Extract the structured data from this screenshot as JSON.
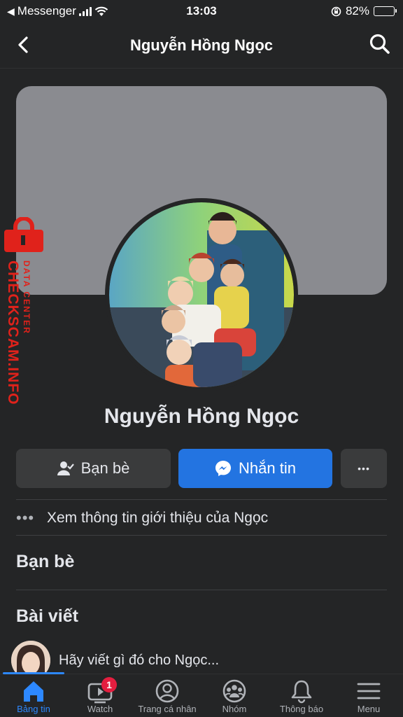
{
  "status_bar": {
    "back_app": "Messenger",
    "time": "13:03",
    "battery_percent": "82%",
    "battery_level": 0.82
  },
  "nav": {
    "title": "Nguyễn Hồng Ngọc"
  },
  "watermark": {
    "line1": "DATA CENTER",
    "line2": "CHECKSCAM.INFO"
  },
  "profile": {
    "name": "Nguyễn Hồng Ngọc"
  },
  "actions": {
    "friends_label": "Bạn bè",
    "message_label": "Nhắn tin",
    "more_label": "•••"
  },
  "about": {
    "dots": "•••",
    "text": "Xem thông tin giới thiệu của Ngọc"
  },
  "sections": {
    "friends_title": "Bạn bè",
    "posts_title": "Bài viết"
  },
  "composer": {
    "placeholder": "Hãy viết gì đó cho Ngọc..."
  },
  "tabbar": {
    "tabs": [
      {
        "label": "Bảng tin",
        "icon": "home-icon",
        "active": true
      },
      {
        "label": "Watch",
        "icon": "watch-icon",
        "badge": "1"
      },
      {
        "label": "Trang cá nhân",
        "icon": "profile-icon"
      },
      {
        "label": "Nhóm",
        "icon": "groups-icon"
      },
      {
        "label": "Thông báo",
        "icon": "bell-icon"
      },
      {
        "label": "Menu",
        "icon": "menu-icon"
      }
    ]
  },
  "colors": {
    "background": "#242526",
    "accent": "#2374e1",
    "active_tab": "#2d88ff",
    "badge": "#e41e3f",
    "watermark": "#e0221b"
  }
}
